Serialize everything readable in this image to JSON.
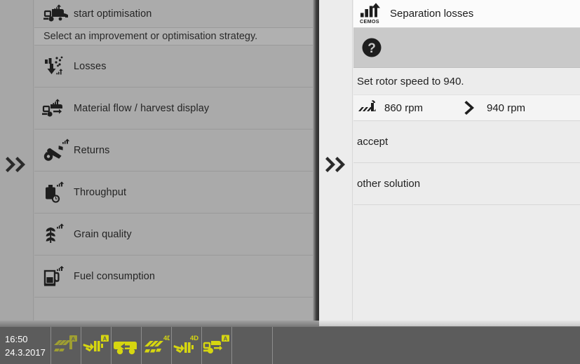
{
  "left_panel": {
    "expand_icon": "double-chevron-right-icon",
    "top_row": {
      "icon": "combine-harvester-optimise-icon",
      "label": "start optimisation"
    },
    "subtitle": "Select an improvement or optimisation strategy.",
    "items": [
      {
        "icon": "losses-icon",
        "label": "Losses"
      },
      {
        "icon": "material-flow-icon",
        "label": "Material flow / harvest display"
      },
      {
        "icon": "returns-icon",
        "label": "Returns"
      },
      {
        "icon": "throughput-icon",
        "label": "Throughput"
      },
      {
        "icon": "grain-quality-icon",
        "label": "Grain quality"
      },
      {
        "icon": "fuel-consumption-icon",
        "label": "Fuel consumption"
      }
    ]
  },
  "right_panel": {
    "expand_icon": "double-chevron-right-icon",
    "header": {
      "icon": "cemos-icon",
      "icon_caption": "CEMOS",
      "label": "Separation losses"
    },
    "help_row": {
      "icon": "question-mark-icon"
    },
    "instruction": "Set rotor speed to 940.",
    "value_row": {
      "icon": "rotor-icon",
      "current": "860 rpm",
      "arrow_icon": "chevron-right-icon",
      "proposed": "940 rpm"
    },
    "actions": [
      {
        "label": "accept"
      },
      {
        "label": "other solution"
      }
    ]
  },
  "bottom_bar": {
    "time": "16:50",
    "date": "24.3.2017",
    "tiles": [
      {
        "icon": "spread-width-inactive-icon",
        "badge": "A",
        "active": false
      },
      {
        "icon": "chopper-auto-icon",
        "badge": "A",
        "active": true
      },
      {
        "icon": "unloading-auto-icon",
        "badge": "",
        "active": true
      },
      {
        "icon": "spread-4d-icon",
        "badge": "4D",
        "active": true
      },
      {
        "icon": "chopper-4d-icon",
        "badge": "4D",
        "active": true
      },
      {
        "icon": "harvester-auto-icon",
        "badge": "A",
        "active": true
      }
    ]
  },
  "colors": {
    "left_panel_bg": "#aaaaaa",
    "right_panel_bg": "#ececec",
    "bottom_bar_bg": "#5c5c5c",
    "accent_yellow": "#d6d610",
    "text_dark": "#1f1f1f"
  }
}
